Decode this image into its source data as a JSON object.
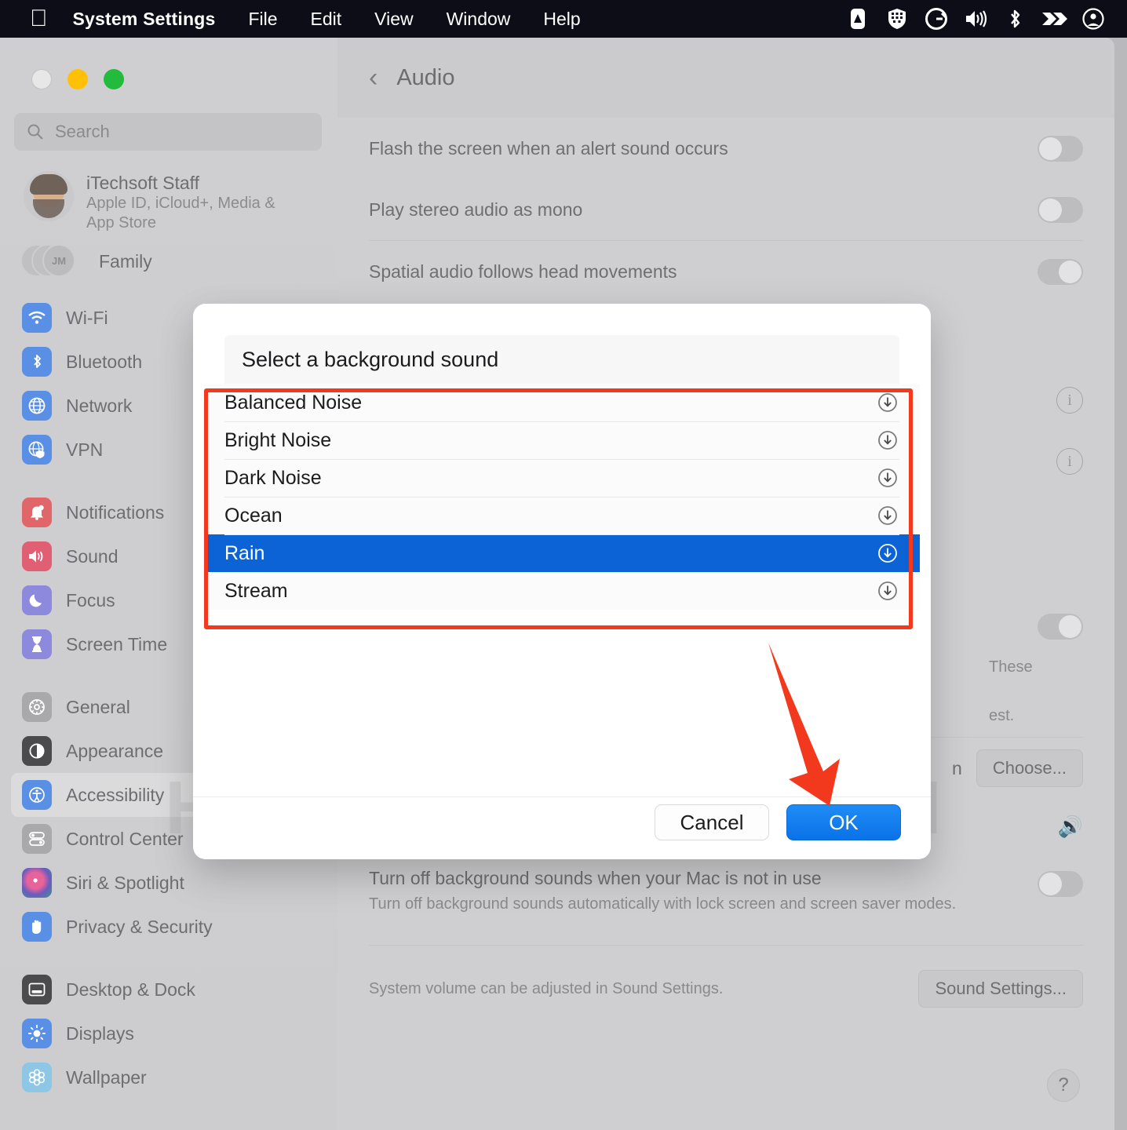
{
  "menubar": {
    "apple_glyph": "apple-logo",
    "app_name": "System Settings",
    "items": [
      "File",
      "Edit",
      "View",
      "Window",
      "Help"
    ],
    "status_icons": [
      {
        "name": "alfred-icon"
      },
      {
        "name": "shield-icon"
      },
      {
        "name": "grammarly-icon"
      },
      {
        "name": "volume-icon"
      },
      {
        "name": "bluetooth-icon"
      },
      {
        "name": "chevron-logo-icon"
      },
      {
        "name": "user-account-icon"
      }
    ]
  },
  "sidebar": {
    "search": {
      "placeholder": "Search"
    },
    "account": {
      "name": "iTechsoft Staff",
      "subtitle": "Apple ID, iCloud+, Media & App Store"
    },
    "family": {
      "label": "Family",
      "badge": "JM"
    },
    "groups": [
      {
        "items": [
          {
            "label": "Wi-Fi",
            "icon": "wifi-icon",
            "color": "#5a8fe6"
          },
          {
            "label": "Bluetooth",
            "icon": "bluetooth-icon",
            "color": "#5a8fe6"
          },
          {
            "label": "Network",
            "icon": "globe-icon",
            "color": "#5a8fe6"
          },
          {
            "label": "VPN",
            "icon": "vpn-shield-icon",
            "color": "#5a8fe6"
          }
        ]
      },
      {
        "items": [
          {
            "label": "Notifications",
            "icon": "bell-icon",
            "color": "#e0666a"
          },
          {
            "label": "Sound",
            "icon": "speaker-icon",
            "color": "#e05f72"
          },
          {
            "label": "Focus",
            "icon": "moon-icon",
            "color": "#8d89dd"
          },
          {
            "label": "Screen Time",
            "icon": "hourglass-icon",
            "color": "#8d89dd"
          }
        ]
      },
      {
        "items": [
          {
            "label": "General",
            "icon": "gear-icon",
            "color": "#a9a9ab"
          },
          {
            "label": "Appearance",
            "icon": "contrast-icon",
            "color": "#4b4b4d"
          },
          {
            "label": "Accessibility",
            "icon": "accessibility-icon",
            "color": "#5a8fe6",
            "active": true
          },
          {
            "label": "Control Center",
            "icon": "control-center-icon",
            "color": "#a9a9ab"
          },
          {
            "label": "Siri & Spotlight",
            "icon": "siri-icon",
            "color": "#9c6fa8"
          },
          {
            "label": "Privacy & Security",
            "icon": "hand-icon",
            "color": "#5a8fe6"
          }
        ]
      },
      {
        "items": [
          {
            "label": "Desktop & Dock",
            "icon": "desktop-dock-icon",
            "color": "#4b4b4d"
          },
          {
            "label": "Displays",
            "icon": "brightness-icon",
            "color": "#5a8fe6"
          },
          {
            "label": "Wallpaper",
            "icon": "wallpaper-icon",
            "color": "#8ec6e6"
          }
        ]
      }
    ]
  },
  "content": {
    "back_label": "Back",
    "title": "Audio",
    "rows": [
      {
        "label": "Flash the screen when an alert sound occurs",
        "control": "toggle",
        "on": false
      },
      {
        "label": "Play stereo audio as mono",
        "control": "toggle",
        "on": false
      },
      {
        "label": "Spatial audio follows head movements",
        "control": "toggle",
        "on": true
      }
    ],
    "info_rows": [
      {
        "control": "info"
      },
      {
        "control": "info"
      }
    ],
    "background_sounds": {
      "toggle_on": true,
      "desc_fragment_1": "These",
      "desc_fragment_2": "est.",
      "choose_label": "Choose...",
      "partial_label": "n"
    },
    "turn_off_row": {
      "title": "Turn off background sounds when your Mac is not in use",
      "subtitle": "Turn off background sounds automatically with lock screen and screen saver modes.",
      "on": false
    },
    "volume_note": {
      "text": "System volume can be adjusted in Sound Settings.",
      "button": "Sound Settings..."
    },
    "help_label": "?"
  },
  "dialog": {
    "title": "Select a background sound",
    "sounds": [
      {
        "name": "Balanced Noise",
        "selected": false,
        "action": "download-icon"
      },
      {
        "name": "Bright Noise",
        "selected": false,
        "action": "download-icon"
      },
      {
        "name": "Dark Noise",
        "selected": false,
        "action": "download-icon"
      },
      {
        "name": "Ocean",
        "selected": false,
        "action": "download-icon"
      },
      {
        "name": "Rain",
        "selected": true,
        "action": "download-icon"
      },
      {
        "name": "Stream",
        "selected": false,
        "action": "download-icon"
      }
    ],
    "cancel_label": "Cancel",
    "ok_label": "OK"
  },
  "annotations": {
    "highlight_color": "#f2391d",
    "arrow_color": "#f2391d",
    "watermark": "HOWTOISOLVE.COM"
  }
}
